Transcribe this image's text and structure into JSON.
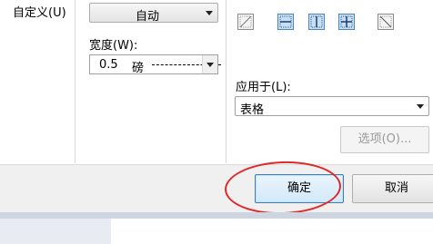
{
  "left_panel": {
    "custom_label": "自定义(U)"
  },
  "middle_panel": {
    "color_select": {
      "value": "自动"
    },
    "width_label": "宽度(W):",
    "width_select": {
      "value": "0.5",
      "unit": "磅"
    }
  },
  "right_panel": {
    "border_buttons": [
      "no-border-icon",
      "inner-horizontal-icon",
      "inner-vertical-icon",
      "inner-grid-icon",
      "diagonal-icon"
    ],
    "apply_to_label": "应用于(L):",
    "apply_to_select": {
      "value": "表格"
    },
    "options_button": "选项(O)..."
  },
  "footer": {
    "ok_button": "确定",
    "cancel_button": "取消"
  },
  "annotation": {
    "color": "#e0282b"
  }
}
